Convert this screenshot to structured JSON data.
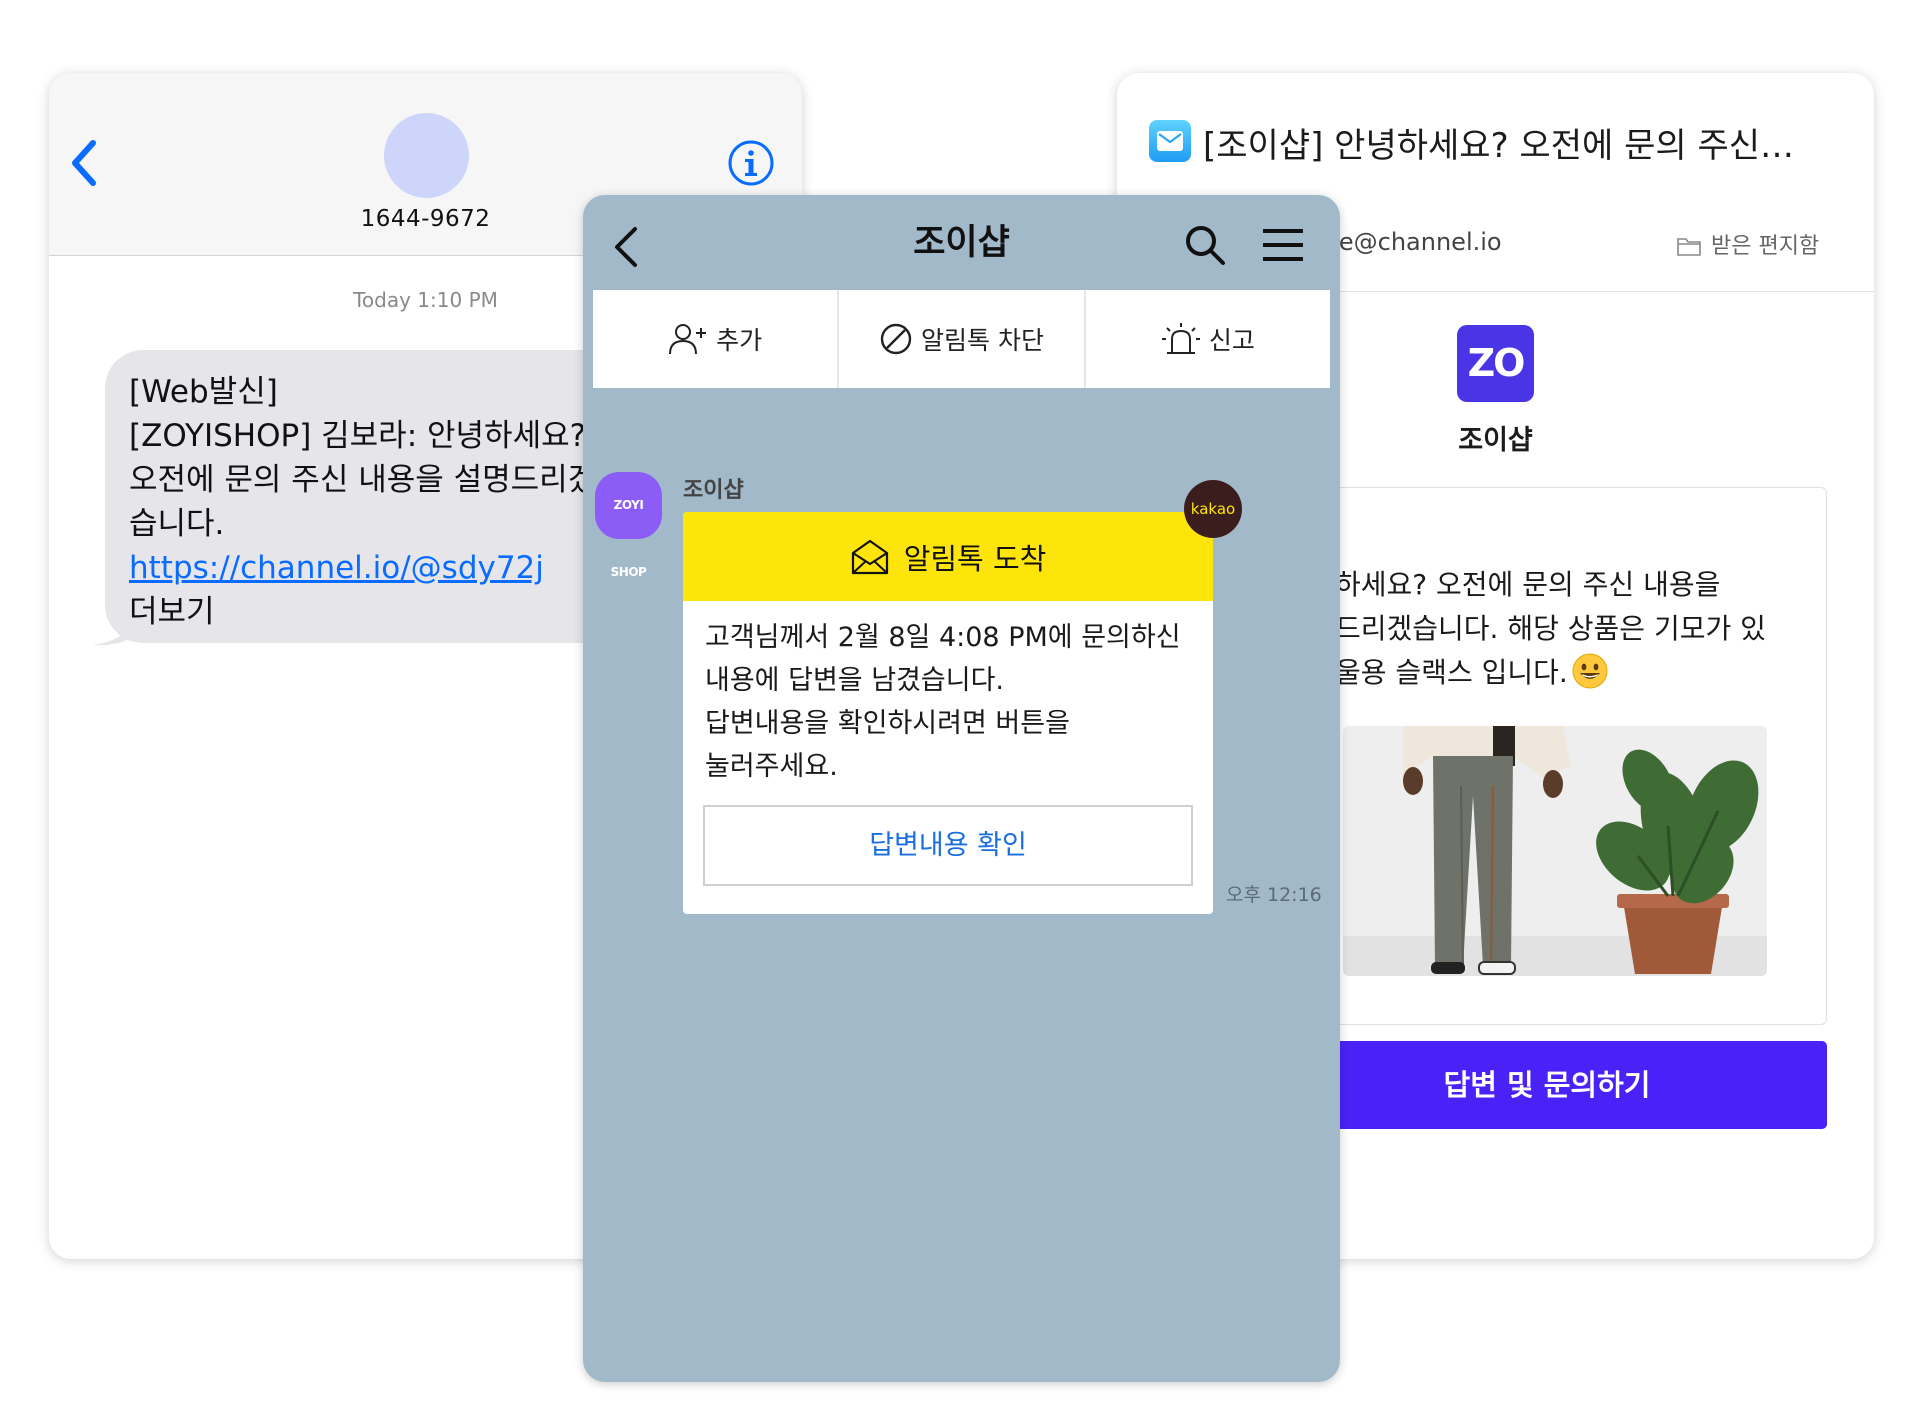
{
  "sms": {
    "contact_number": "1644-9672",
    "timestamp": "Today 1:10 PM",
    "message_lines": [
      "[Web발신]",
      "[ZOYISHOP] 김보라: 안녕하세요?",
      "오전에 문의 주신 내용을 설명드리겠",
      "습니다."
    ],
    "link": "https://channel.io/@sdy72j",
    "more": "더보기"
  },
  "email": {
    "subject": "[조이샵] 안녕하세요? 오전에 문의 주신…",
    "sender": "nie@channel.io",
    "folder": "받은 편지함",
    "logo_text": "ZO",
    "brand_name": "조이샵",
    "body_lines": [
      "하세요? 오전에 문의 주신 내용을",
      "드리겠습니다. 해당 상품은 기모가 있",
      "울용 슬랙스 입니다."
    ],
    "cta_label": "답변 및 문의하기",
    "accent_color": "#4a22f7"
  },
  "kakao": {
    "title": "조이샵",
    "actions": [
      "추가",
      "알림톡 차단",
      "신고"
    ],
    "avatar_text": "ZOYI SHOP",
    "sender_name": "조이샵",
    "card_header": "알림톡 도착",
    "card_body_lines": [
      "고객님께서 2월 8일 4:08 PM에 문의하신",
      "내용에 답변을 남겼습니다.",
      "답변내용을 확인하시려면 버튼을",
      "눌러주세요."
    ],
    "card_button": "답변내용 확인",
    "badge_text": "kakao",
    "time": "오후 12:16",
    "background_color": "#a2b9ca",
    "header_color": "#fde50c"
  }
}
